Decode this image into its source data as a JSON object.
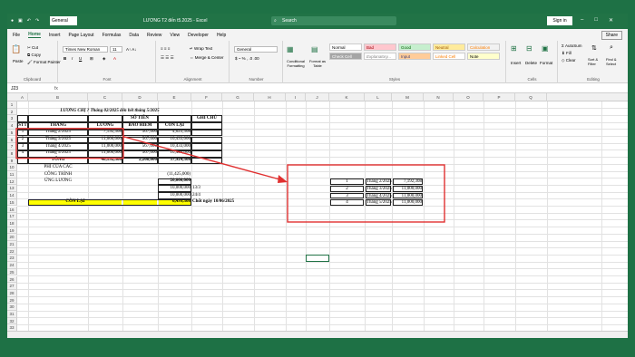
{
  "titlebar": {
    "font_name": "General",
    "title": "LƯƠNG T2 đến t5.2025  -  Excel",
    "search_placeholder": "Search",
    "sign_in": "Sign in"
  },
  "tabs": [
    "File",
    "Home",
    "Insert",
    "Page Layout",
    "Formulas",
    "Data",
    "Review",
    "View",
    "Developer",
    "Help"
  ],
  "share": "Share",
  "ribbon": {
    "clipboard": {
      "cut": "Cut",
      "copy": "Copy",
      "format_painter": "Format Painter",
      "label": "Clipboard"
    },
    "font": {
      "font_name": "Times New Roman",
      "font_size": "11",
      "label": "Font"
    },
    "alignment": {
      "wrap": "Wrap Text",
      "merge": "Merge & Center",
      "label": "Alignment"
    },
    "number": {
      "format": "General",
      "label": "Number"
    },
    "styles": {
      "conditional": "Conditional Formatting",
      "format_as_table": "Format as Table",
      "normal": "Normal",
      "bad": "Bad",
      "good": "Good",
      "neutral": "Neutral",
      "calculation": "Calculation",
      "check_cell": "Check Cell",
      "explanatory": "Explanatory...",
      "input": "Input",
      "linked": "Linked Cell",
      "note": "Note",
      "label": "Styles"
    },
    "cells": {
      "insert": "Insert",
      "delete": "Delete",
      "format": "Format",
      "label": "Cells"
    },
    "editing": {
      "autosum": "AutoSum",
      "fill": "Fill",
      "clear": "Clear",
      "sort": "Sort & Filter",
      "find": "Find & Select",
      "label": "Editing"
    }
  },
  "formula_bar": {
    "name_box": "J23",
    "fx": "fx"
  },
  "columns": [
    "A",
    "B",
    "C",
    "D",
    "E",
    "F",
    "G",
    "H",
    "I",
    "J",
    "K",
    "L",
    "M",
    "N",
    "O",
    "P",
    "Q"
  ],
  "rows": [
    "1",
    "2",
    "3",
    "4",
    "5",
    "6",
    "7",
    "8",
    "9",
    "10",
    "11",
    "12",
    "13",
    "14",
    "15",
    "16",
    "17",
    "18",
    "19",
    "20",
    "21",
    "22",
    "23",
    "24",
    "25",
    "26",
    "27",
    "28",
    "29",
    "30",
    "31",
    "32",
    "33",
    "34",
    "35"
  ],
  "sheet": {
    "title": "LƯƠNG CHỊ ? Tháng 02/2025 đến hết tháng 5/2025",
    "headers": {
      "stt": "STT",
      "thang": "THÁNG",
      "so_tien": "SỐ TIỀN",
      "luong": "LƯƠNG",
      "bao_hiem": "BẢO HIỂM",
      "con_lai": "CÒN LẠI",
      "ghi_chu": "GHI CHÚ"
    },
    "data_rows": [
      {
        "stt": "1",
        "thang": "Tháng 2/2025",
        "luong": "7,192,308",
        "bao_hiem": "567,000",
        "con_lai": "4,625,308"
      },
      {
        "stt": "2",
        "thang": "Tháng 3/2025",
        "luong": "11,000,000",
        "bao_hiem": "567,000",
        "con_lai": "10,433,000"
      },
      {
        "stt": "3",
        "thang": "Tháng 4/2025",
        "luong": "11,000,000",
        "bao_hiem": "567,000",
        "con_lai": "10,433,000"
      },
      {
        "stt": "4",
        "thang": "Tháng 5/2025",
        "luong": "11,000,000",
        "bao_hiem": "567,000",
        "con_lai": "10,433,000"
      }
    ],
    "tong_label": "TỔNG",
    "tong_luong": "40,192,308",
    "tong_bao_hiem": "2,268,000",
    "tong_con_lai": "37,924,308",
    "phi": [
      "PHÍ CỦA CÁC",
      "CÔNG TRÌNH",
      "ỨNG LƯƠNG"
    ],
    "phi_value": "(11,425,000)",
    "ung_total": "20,000,000",
    "ung1": "10,000,000",
    "ung1_note": "13/3",
    "ung2": "10,000,000",
    "ung2_note": "24/4",
    "con_lai_label": "CÒN LẠI",
    "con_lai_value": "6,499,308",
    "chot": "Chốt ngày 10/06/2025",
    "copy_rows": [
      {
        "stt": "1",
        "thang": "Tháng 2/2025",
        "luong": "7,192,308"
      },
      {
        "stt": "2",
        "thang": "Tháng 3/2025",
        "luong": "11,000,000"
      },
      {
        "stt": "3",
        "thang": "Tháng 4/2025",
        "luong": "11,000,000"
      },
      {
        "stt": "4",
        "thang": "Tháng 5/2025",
        "luong": "11,000,000"
      }
    ]
  },
  "colors": {
    "excel_green": "#217346",
    "highlight_yellow": "#ffff00",
    "annotation_red": "#e03030"
  }
}
